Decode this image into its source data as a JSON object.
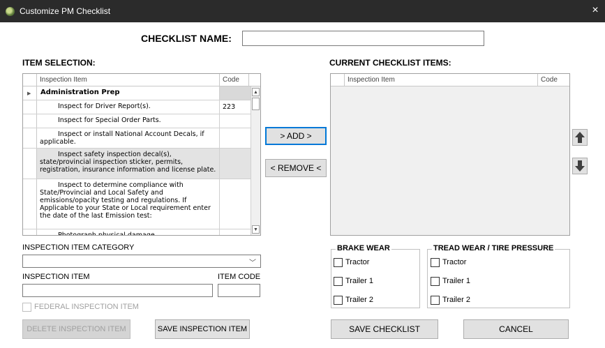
{
  "window": {
    "title": "Customize PM Checklist",
    "close_glyph": "×",
    "app_icon": "app-logo-icon"
  },
  "checklist_name": {
    "label": "CHECKLIST NAME:",
    "value": ""
  },
  "item_selection": {
    "title": "ITEM SELECTION:",
    "columns": [
      "Inspection Item",
      "Code"
    ],
    "rows": [
      {
        "item": "Administration Prep",
        "code": ""
      },
      {
        "item": "Inspect for Driver Report(s).",
        "code": "223"
      },
      {
        "item": "Inspect for Special Order Parts.",
        "code": ""
      },
      {
        "item": "Inspect or install National Account Decals, if applicable.",
        "code": ""
      },
      {
        "item": "Inspect safety inspection decal(s), state/provincial inspection sticker, permits, registration, insurance information and license plate.",
        "code": ""
      },
      {
        "item": "Inspect to determine compliance with State/Provincial and Local Safety and emissions/opacity testing and regulations. If Applicable to your State or Local requirement enter the date of the last Emission test:",
        "code": ""
      },
      {
        "item": "Photograph physical damage",
        "code": ""
      }
    ]
  },
  "current_items": {
    "title": "CURRENT CHECKLIST ITEMS:",
    "columns": [
      "Inspection Item",
      "Code"
    ]
  },
  "buttons": {
    "add": "> ADD >",
    "remove": "< REMOVE <",
    "delete_item": "DELETE INSPECTION ITEM",
    "save_item": "SAVE INSPECTION ITEM",
    "save_checklist": "SAVE CHECKLIST",
    "cancel": "CANCEL"
  },
  "form": {
    "category_label": "INSPECTION ITEM CATEGORY",
    "category_value": "",
    "item_label": "INSPECTION ITEM",
    "item_value": "",
    "code_label": "ITEM CODE",
    "code_value": "",
    "federal_label": "FEDERAL INSPECTION ITEM",
    "federal_checked": false
  },
  "brake_wear": {
    "title": "BRAKE WEAR",
    "options": [
      {
        "label": "Tractor",
        "checked": false
      },
      {
        "label": "Trailer 1",
        "checked": false
      },
      {
        "label": "Trailer 2",
        "checked": false
      }
    ]
  },
  "tread_wear": {
    "title": "TREAD WEAR / TIRE PRESSURE",
    "options": [
      {
        "label": "Tractor",
        "checked": false
      },
      {
        "label": "Trailer 1",
        "checked": false
      },
      {
        "label": "Trailer 2",
        "checked": false
      }
    ]
  },
  "colors": {
    "titlebar": "#2b2b2b",
    "accent": "#0078d7",
    "selected_row": "#e3e3e3"
  }
}
